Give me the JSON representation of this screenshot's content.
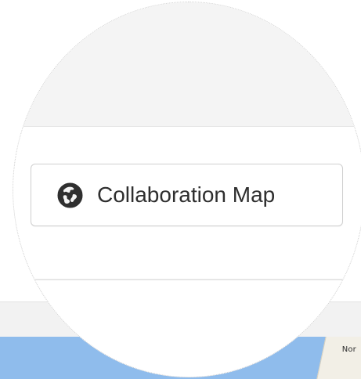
{
  "toolbar": {
    "collaboration_map_label": "Collaboration Map",
    "collaboration_map_icon": "globe-icon"
  },
  "map": {
    "partial_label": "Nor"
  },
  "colors": {
    "button_border": "#cfcfcf",
    "button_text": "#2f2f2f",
    "icon_fill": "#2f2f2f",
    "band_gray": "#f4f4f4",
    "water_blue": "#8fbcec"
  }
}
